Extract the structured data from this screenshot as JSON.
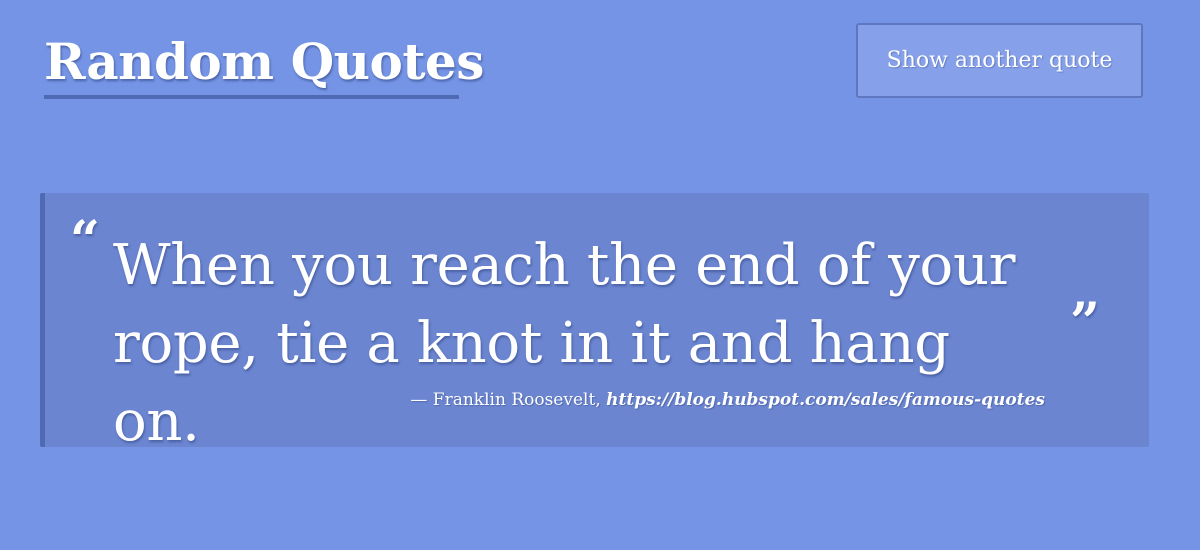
{
  "header": {
    "title": "Random Quotes",
    "button_label": "Show another quote"
  },
  "quote": {
    "open_mark": "“",
    "text": "When you reach the end of your rope, tie a knot in it and hang on.",
    "close_mark": "”",
    "dash": "— ",
    "author": "Franklin Roosevelt",
    "separator": ", ",
    "source": "https://blog.hubspot.com/sales/famous-quotes"
  },
  "colors": {
    "background": "#7594e5",
    "card": "#6b85d0",
    "accent": "#4f6ab2",
    "button": "#86a0ea",
    "text": "#ffffff"
  }
}
